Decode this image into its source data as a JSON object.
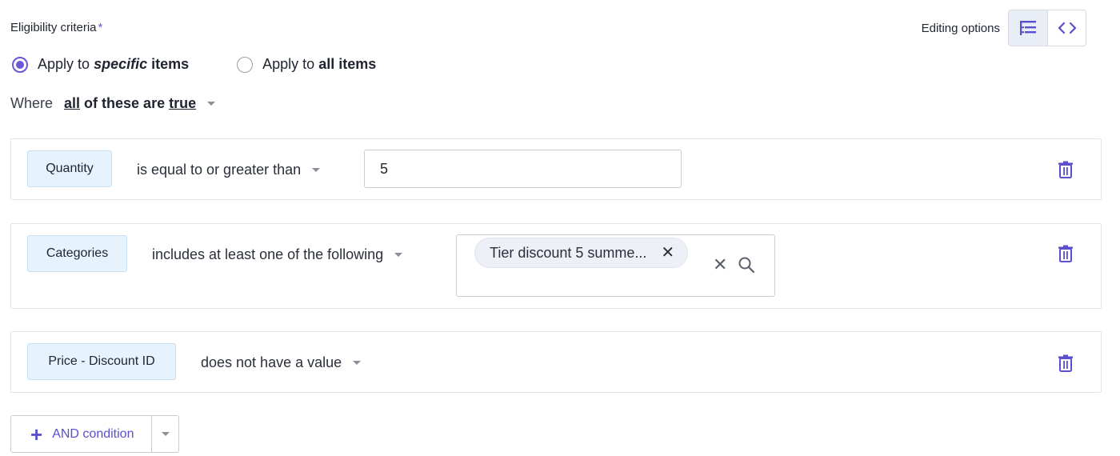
{
  "header": {
    "label": "Eligibility criteria",
    "required_mark": "*",
    "editing_label": "Editing options"
  },
  "apply": {
    "specific_prefix": "Apply to",
    "specific_em": "specific",
    "specific_suffix": "items",
    "all_prefix": "Apply to",
    "all_bold": "all items",
    "selected": "specific"
  },
  "where": {
    "prefix": "Where",
    "all": "all",
    "middle": "of these are",
    "true": "true"
  },
  "conditions": [
    {
      "field": "Quantity",
      "operator": "is equal to or greater than",
      "value": "5"
    },
    {
      "field": "Categories",
      "operator": "includes at least one of the following",
      "tags": [
        "Tier discount 5 summe..."
      ]
    },
    {
      "field": "Price - Discount ID",
      "operator": "does not have a value"
    }
  ],
  "add_button": {
    "label": "AND condition"
  },
  "colors": {
    "accent": "#6b56d8",
    "chip_bg": "#e6f2fc",
    "icon": "#5a4fcf"
  }
}
